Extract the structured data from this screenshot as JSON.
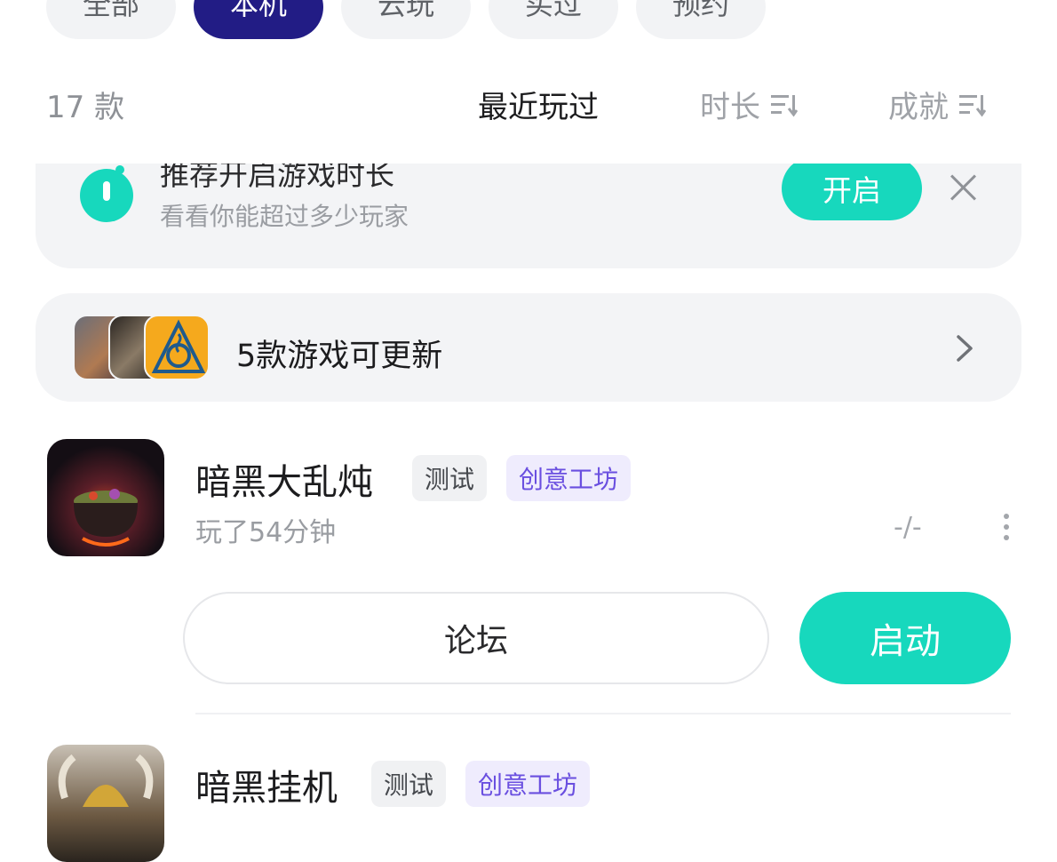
{
  "filter_tabs": [
    {
      "label": "全部",
      "active": false
    },
    {
      "label": "本机",
      "active": true
    },
    {
      "label": "云玩",
      "active": false
    },
    {
      "label": "买过",
      "active": false
    },
    {
      "label": "预约",
      "active": false
    }
  ],
  "sort_bar": {
    "count": "17 款",
    "options": [
      {
        "label": "最近玩过",
        "active": true
      },
      {
        "label": "时长",
        "active": false,
        "icon": "sort-icon"
      },
      {
        "label": "成就",
        "active": false,
        "icon": "sort-icon"
      }
    ]
  },
  "reminder": {
    "title": "推荐开启游戏时长",
    "subtitle": "看看你能超过多少玩家",
    "button": "开启",
    "icon": "timer-icon",
    "close_icon": "close-icon"
  },
  "updates": {
    "text": "5款游戏可更新",
    "icon": "chevron-right-icon"
  },
  "games": [
    {
      "title": "暗黑大乱炖",
      "tags": [
        "测试",
        "创意工坊"
      ],
      "play_time": "玩了54分钟",
      "achievement": "-/-",
      "forum_button": "论坛",
      "launch_button": "启动"
    },
    {
      "title": "暗黑挂机",
      "tags": [
        "测试",
        "创意工坊"
      ]
    }
  ],
  "colors": {
    "brand_teal": "#17d8bd",
    "active_tab": "#221c85",
    "workshop_tag": "#6a4fe0"
  }
}
